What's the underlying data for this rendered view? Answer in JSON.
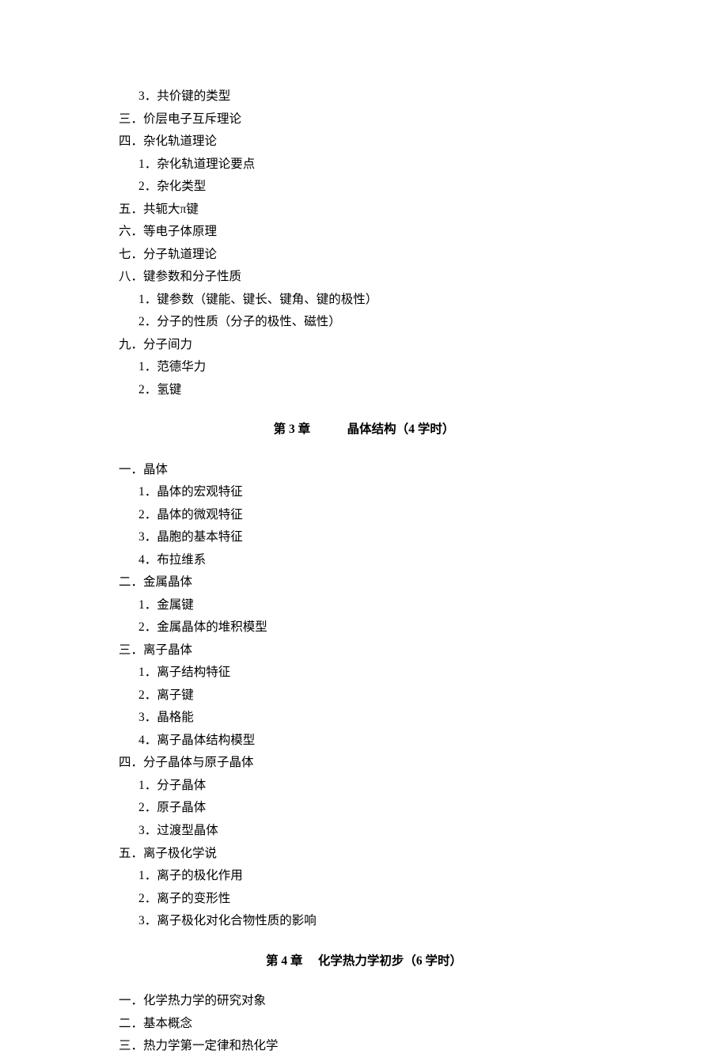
{
  "pre": {
    "item_3": "3．共价键的类型",
    "san": "三．价层电子互斥理论",
    "si": "四．杂化轨道理论",
    "si_1": "1．杂化轨道理论要点",
    "si_2": "2．杂化类型",
    "wu": "五．共轭大π键",
    "liu": "六．等电子体原理",
    "qi": "七．分子轨道理论",
    "ba": "八．键参数和分子性质",
    "ba_1": "1．键参数（键能、键长、键角、键的极性）",
    "ba_2": "2．分子的性质（分子的极性、磁性）",
    "jiu": "九．分子间力",
    "jiu_1": "1．范德华力",
    "jiu_2": "2．氢键"
  },
  "chapter3": {
    "title_prefix": "第 ",
    "title_num": "3",
    "title_mid": " 章　　　晶体结构（",
    "title_hours": "4",
    "title_suffix": " 学时）",
    "yi": "一．晶体",
    "yi_1": "1．晶体的宏观特征",
    "yi_2": "2．晶体的微观特征",
    "yi_3": "3．晶胞的基本特征",
    "yi_4": "4．布拉维系",
    "er": "二．金属晶体",
    "er_1": "1．金属键",
    "er_2": "2．金属晶体的堆积模型",
    "san": "三．离子晶体",
    "san_1": "1．离子结构特征",
    "san_2": "2．离子键",
    "san_3": "3．晶格能",
    "san_4": "4．离子晶体结构模型",
    "si": "四．分子晶体与原子晶体",
    "si_1": "1．分子晶体",
    "si_2": "2．原子晶体",
    "si_3": "3．过渡型晶体",
    "wu": "五．离子极化学说",
    "wu_1": "1．离子的极化作用",
    "wu_2": "2．离子的变形性",
    "wu_3": "3．离子极化对化合物性质的影响"
  },
  "chapter4": {
    "title_prefix": "第 ",
    "title_num": "4",
    "title_mid": " 章　 化学热力学初步（",
    "title_hours": "6",
    "title_suffix": " 学时）",
    "yi": "一．化学热力学的研究对象",
    "er": "二．基本概念",
    "san": "三．热力学第一定律和热化学"
  }
}
